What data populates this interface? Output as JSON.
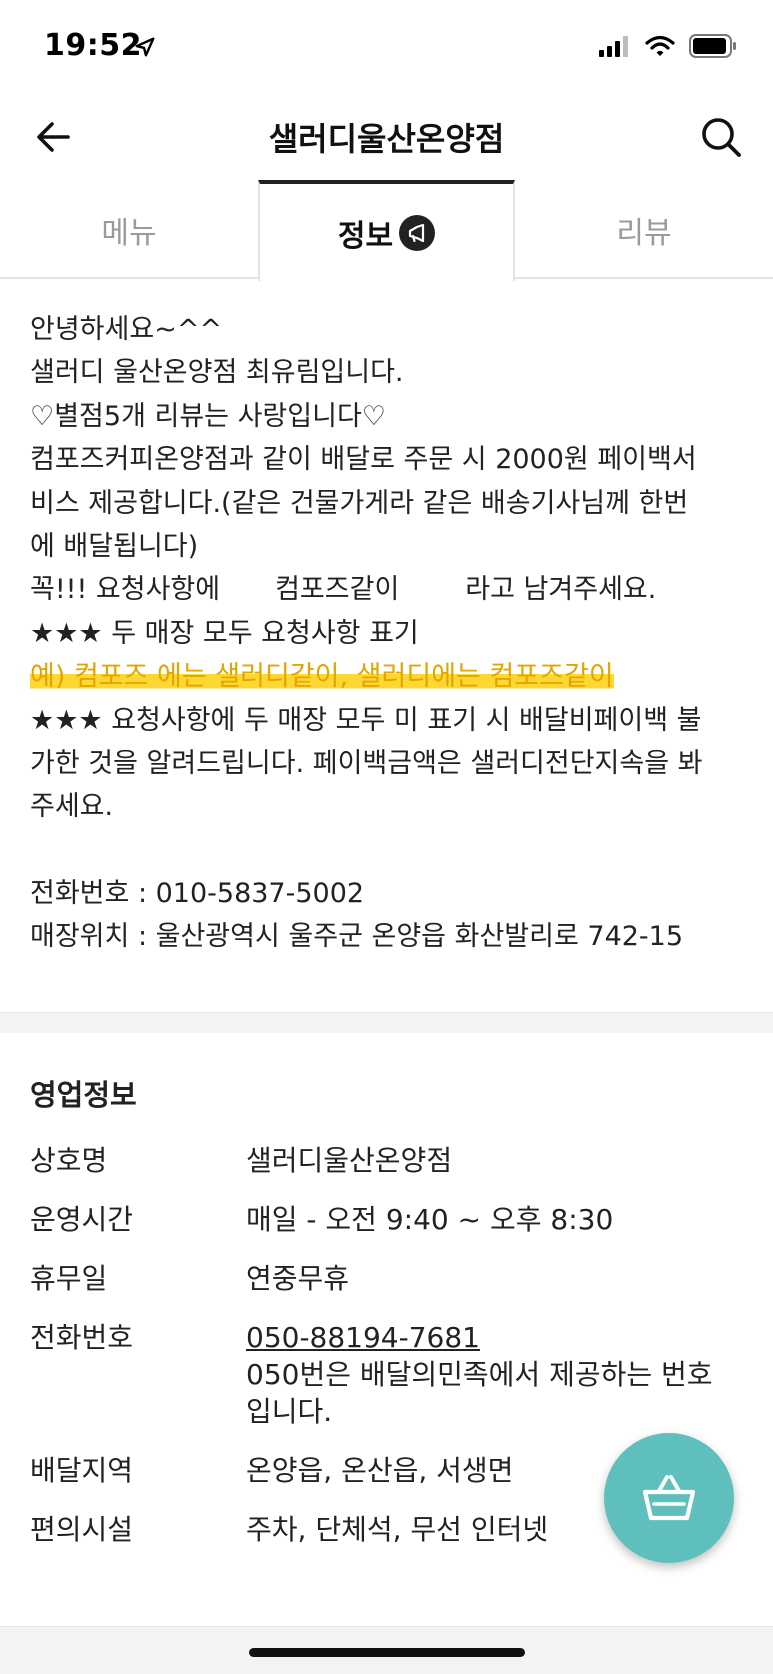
{
  "status_bar": {
    "time": "19:52"
  },
  "header": {
    "title": "샐러디울산온양점"
  },
  "tabs": [
    {
      "label": "메뉴"
    },
    {
      "label": "정보"
    },
    {
      "label": "리뷰"
    }
  ],
  "notice": {
    "lines": [
      "안녕하세요~^^",
      "샐러디 울산온양점 최유림입니다.",
      "♡별점5개 리뷰는 사랑입니다♡",
      "컴포즈커피온양점과 같이 배달로 주문 시 2000원 페이백서",
      "비스 제공합니다.(같은 건물가게라 같은 배송기사님께 한번",
      "에 배달됩니다)"
    ],
    "request_prefix": "꼭!!! 요청사항에",
    "request_keyword": "컴포즈같이",
    "request_suffix": "라고 남겨주세요.",
    "star_line": "★★★ 두 매장 모두 요청사항 표기",
    "highlight_line": "예) 컴포즈 에는 샐러디같이,  샐러디에는 컴포즈같이",
    "warning_lines": [
      "★★★ 요청사항에 두 매장 모두 미 표기 시 배달비페이백 불",
      "가한 것을 알려드립니다. 페이백금액은 샐러디전단지속을 봐",
      "주세요."
    ],
    "phone_line": "전화번호 : 010-5837-5002",
    "location_line": "매장위치 : 울산광역시 울주군 온양읍 화산발리로 742-15"
  },
  "business_info": {
    "title": "영업정보",
    "rows": [
      {
        "key": "상호명",
        "value": "샐러디울산온양점"
      },
      {
        "key": "운영시간",
        "value": "매일 - 오전 9:40 ~ 오후 8:30"
      },
      {
        "key": "휴무일",
        "value": "연중무휴"
      },
      {
        "key": "전화번호",
        "value": "050-88194-7681",
        "note_1": "050번은 배달의민족에서 제공하는 번호",
        "note_2": "입니다."
      },
      {
        "key": "배달지역",
        "value": "온양읍, 온산읍, 서생면"
      },
      {
        "key": "편의시설",
        "value": "주차, 단체석, 무선 인터넷"
      }
    ]
  },
  "colors": {
    "accent_fab": "#5fbfbc",
    "highlight": "#ffd733",
    "highlight_text": "#e3a600"
  },
  "icons": [
    "location-arrow-icon",
    "signal-icon",
    "wifi-icon",
    "battery-icon",
    "back-arrow-icon",
    "search-icon",
    "megaphone-icon",
    "cart-basket-icon"
  ]
}
